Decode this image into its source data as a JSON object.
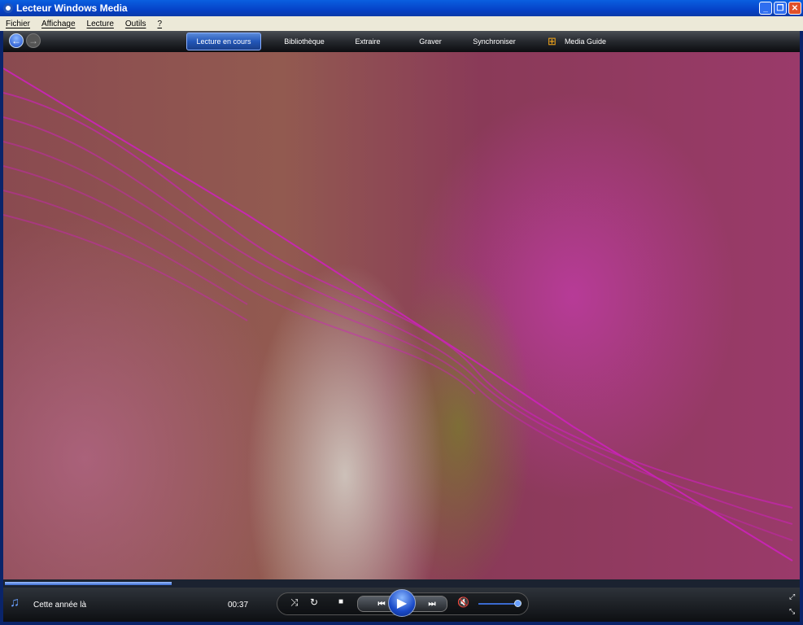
{
  "window": {
    "title": "Lecteur Windows Media"
  },
  "menu": [
    "Fichier",
    "Affichage",
    "Lecture",
    "Outils",
    "?"
  ],
  "tabs": [
    "Lecture en cours",
    "Bibliothèque",
    "Extraire",
    "Graver",
    "Synchroniser",
    "Media Guide"
  ],
  "active_tab": "Lecture en cours",
  "player": {
    "track": "Cette année là",
    "time": "00:37",
    "seek_progress": 0.21,
    "volume": 0.95
  },
  "colors": {
    "accent": "#2256b8",
    "viz_magenta": "#d020c0"
  }
}
